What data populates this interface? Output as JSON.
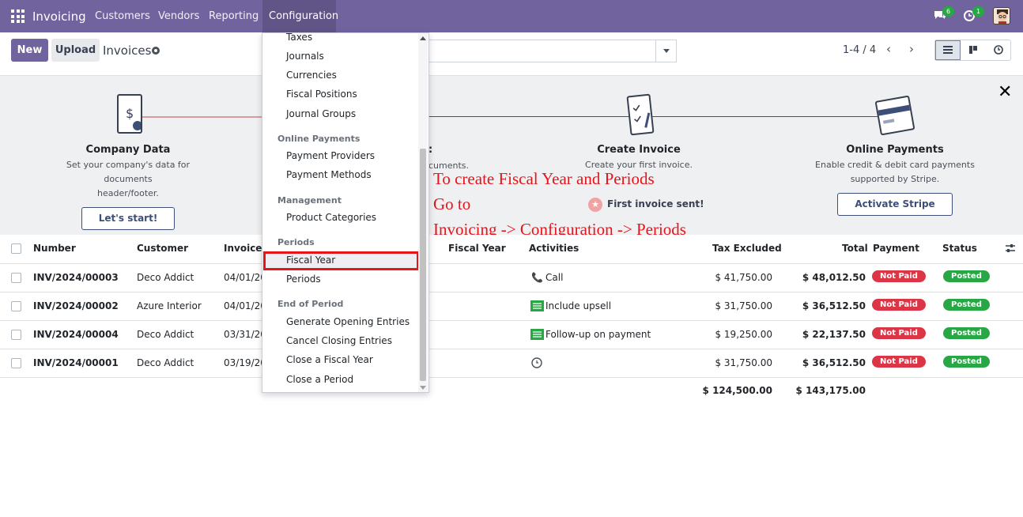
{
  "topbar": {
    "app": "Invoicing",
    "menus": [
      "Customers",
      "Vendors",
      "Reporting",
      "Configuration"
    ],
    "chat_count": "6",
    "activity_count": "1"
  },
  "control": {
    "new": "New",
    "upload": "Upload",
    "breadcrumb": "Invoices",
    "pager": "1-4 / 4"
  },
  "onboarding": {
    "steps": [
      {
        "title": "Company Data",
        "desc1": "Set your company's data for documents",
        "desc2": "header/footer.",
        "button": "Let's start!"
      },
      {
        "title_partial": ":",
        "desc_partial": "cuments."
      },
      {
        "title": "Create Invoice",
        "desc1": "Create your first invoice.",
        "status": "First invoice sent!"
      },
      {
        "title": "Online Payments",
        "desc1": "Enable credit & debit card payments",
        "desc2": "supported by Stripe.",
        "button": "Activate Stripe"
      }
    ],
    "annotation": [
      "To create Fiscal Year and Periods",
      "Go to",
      "Invoicing -> Configuration -> Periods"
    ]
  },
  "table": {
    "headers": [
      "Number",
      "Customer",
      "Invoice D",
      "Fiscal Year",
      "Activities",
      "Tax Excluded",
      "Total",
      "Payment",
      "Status"
    ],
    "rows": [
      {
        "number": "INV/2024/00003",
        "customer": "Deco Addict",
        "date": "04/01/20",
        "activity": "Call",
        "tax_excluded": "$ 41,750.00",
        "total": "$ 48,012.50",
        "payment": "Not Paid",
        "status": "Posted"
      },
      {
        "number": "INV/2024/00002",
        "customer": "Azure Interior",
        "date": "04/01/20",
        "activity": "Include upsell",
        "tax_excluded": "$ 31,750.00",
        "total": "$ 36,512.50",
        "payment": "Not Paid",
        "status": "Posted"
      },
      {
        "number": "INV/2024/00004",
        "customer": "Deco Addict",
        "date": "03/31/20",
        "activity": "Follow-up on payment",
        "tax_excluded": "$ 19,250.00",
        "total": "$ 22,137.50",
        "payment": "Not Paid",
        "status": "Posted"
      },
      {
        "number": "INV/2024/00001",
        "customer": "Deco Addict",
        "date": "03/19/20",
        "activity": "",
        "tax_excluded": "$ 31,750.00",
        "total": "$ 36,512.50",
        "payment": "Not Paid",
        "status": "Posted"
      }
    ],
    "totals": {
      "tax_excluded": "$ 124,500.00",
      "total": "$ 143,175.00"
    }
  },
  "dropdown": {
    "items_top": [
      "Taxes",
      "Journals",
      "Currencies",
      "Fiscal Positions",
      "Journal Groups"
    ],
    "online_payments": {
      "header": "Online Payments",
      "items": [
        "Payment Providers",
        "Payment Methods"
      ]
    },
    "management": {
      "header": "Management",
      "items": [
        "Product Categories"
      ]
    },
    "periods": {
      "header": "Periods",
      "items": [
        "Fiscal Year",
        "Periods"
      ]
    },
    "end_of_period": {
      "header": "End of Period",
      "items": [
        "Generate Opening Entries",
        "Cancel Closing Entries",
        "Close a Fiscal Year",
        "Close a Period"
      ]
    }
  }
}
